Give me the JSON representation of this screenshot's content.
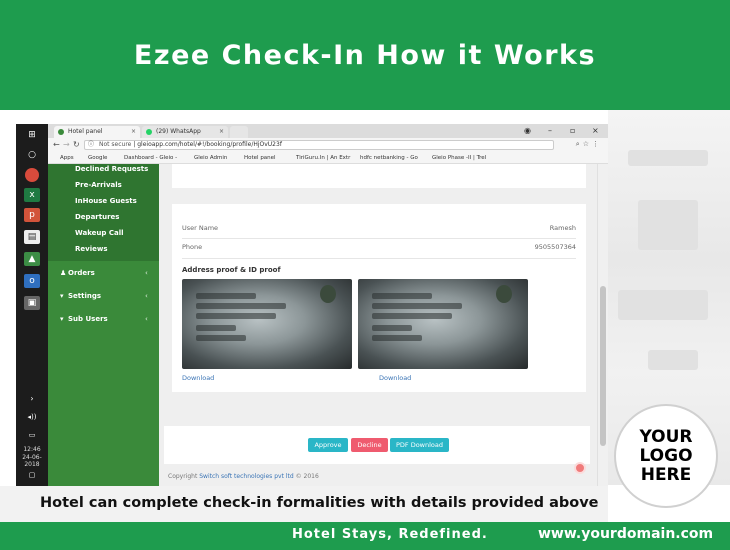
{
  "slide": {
    "title": "Ezee Check-In How it Works",
    "caption": "Hotel can complete check-in formalities with details provided above",
    "tagline": "Hotel Stays, Redefined.",
    "domain": "www.yourdomain.com",
    "logo_lines": [
      "YOUR",
      "LOGO",
      "HERE"
    ],
    "colors": {
      "brand_green": "#1e9c4e",
      "sidebar_green": "#3a8a3a"
    }
  },
  "taskbar": {
    "time": "12:46",
    "date": "24-06-2018",
    "icons": [
      "windows-icon",
      "cortana-icon",
      "chrome-icon",
      "excel-icon",
      "powerpoint-icon",
      "film-icon",
      "photos-icon",
      "outlook-icon",
      "image-icon"
    ]
  },
  "browser": {
    "tabs": [
      {
        "label": "Hotel panel",
        "active": true
      },
      {
        "label": "(29) WhatsApp",
        "active": false
      }
    ],
    "url_prefix": "Not secure",
    "url": "gleioapp.com/hotel/#!/booking/profile/HjOvU23f",
    "bookmarks": [
      "Apps",
      "Google",
      "Dashboard - Gleio -",
      "Gleio Admin",
      "Hotel panel",
      "TiriGuru.In | An Extr",
      "hdfc netbanking - Go",
      "Gleio Phase -II | Trel"
    ]
  },
  "sidebar": {
    "sub_items": [
      "Declined Requests",
      "Pre-Arrivals",
      "InHouse Guests",
      "Departures",
      "Wakeup Call",
      "Reviews"
    ],
    "main_items": [
      {
        "label": "Orders",
        "icon": "bell-icon"
      },
      {
        "label": "Settings",
        "icon": "cart-icon"
      },
      {
        "label": "Sub Users",
        "icon": "cart-icon"
      }
    ]
  },
  "profile": {
    "user_name_label": "User Name",
    "user_name_value": "Ramesh",
    "phone_label": "Phone",
    "phone_value": "9505507364",
    "id_section_title": "Address proof & ID proof",
    "download_label": "Download"
  },
  "actions": {
    "approve": "Approve",
    "decline": "Decline",
    "pdf": "PDF Download",
    "colors": {
      "approve": "#2ab6c7",
      "decline": "#ef5b6f",
      "pdf": "#2ab6c7"
    }
  },
  "footer": {
    "copyright_prefix": "Copyright",
    "company": "Switch soft technologies pvt ltd",
    "year": "© 2016"
  }
}
